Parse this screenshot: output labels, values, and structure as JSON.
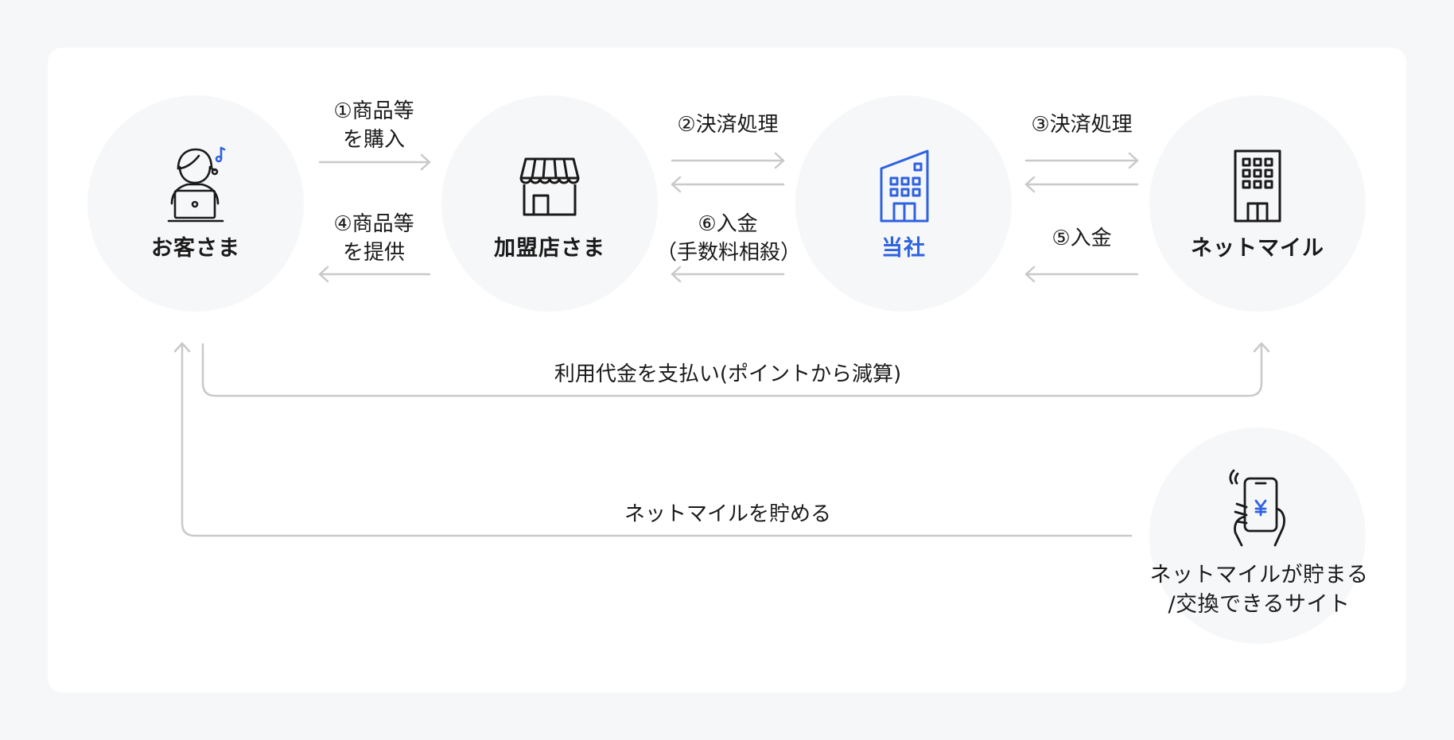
{
  "nodes": {
    "customer": "お客さま",
    "merchant": "加盟店さま",
    "company": "当社",
    "netmile": "ネットマイル",
    "site": "ネットマイルが貯まる\n/交換できるサイト"
  },
  "arrows": {
    "a1_line1": "①商品等",
    "a1_line2": "を購入",
    "a4_line1": "④商品等",
    "a4_line2": "を提供",
    "a2": "②決済処理",
    "a6_line1": "⑥入金",
    "a6_line2": "（手数料相殺）",
    "a3": "③決済処理",
    "a5": "⑤入金",
    "pay": "利用代金を支払い(ポイントから減算)",
    "earn": "ネットマイルを貯める"
  },
  "colors": {
    "accent": "#2f62e0",
    "node_bg": "#f6f7f9",
    "arrow": "#c9c9c9"
  },
  "icons": [
    "customer-laptop-icon",
    "store-icon",
    "company-building-icon",
    "netmile-building-icon",
    "smartphone-yen-icon"
  ]
}
